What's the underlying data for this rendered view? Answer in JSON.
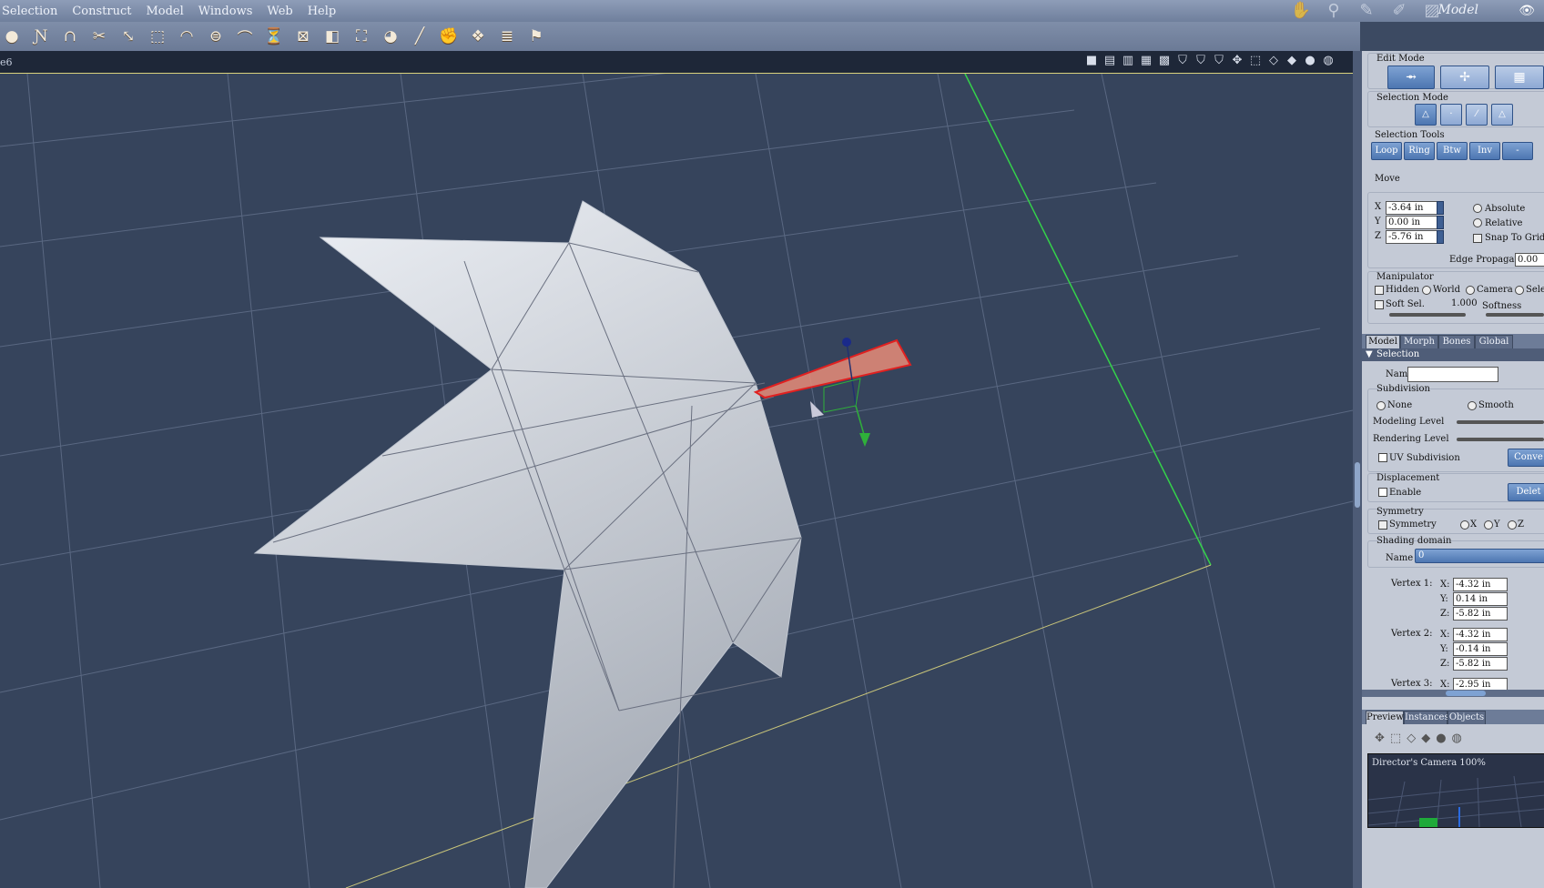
{
  "menu": [
    "Selection",
    "Construct",
    "Model",
    "Windows",
    "Web",
    "Help"
  ],
  "room": {
    "name": "Model",
    "tab_icons": [
      "hand-room-icon",
      "bone-room-icon",
      "pen-room-icon",
      "brush-room-icon",
      "cloth-room-icon"
    ]
  },
  "toolbar": {
    "icons": [
      "sphere-icon",
      "path-icon",
      "magnet-icon",
      "scissors-icon",
      "weld-icon",
      "bevel-icon",
      "dome-icon",
      "lathe-icon",
      "bend-icon",
      "taper-icon",
      "box-icon",
      "shaded-box-icon",
      "bag-icon",
      "half-sphere-icon",
      "line-icon",
      "grab-icon",
      "shape-icon",
      "stack-icon",
      "flag-icon"
    ]
  },
  "viewport": {
    "label": "e6"
  },
  "panel": {
    "edit_mode": {
      "title": "Edit Mode"
    },
    "selection_mode": {
      "title": "Selection Mode"
    },
    "selection_tools": {
      "title": "Selection Tools",
      "buttons": [
        "Loop",
        "Ring",
        "Btw",
        "Inv",
        "-"
      ]
    },
    "move": {
      "title": "Move",
      "x_label": "X",
      "x": "-3.64 in",
      "y_label": "Y",
      "y": "0.00 in",
      "z_label": "Z",
      "z": "-5.76 in",
      "absolute": "Absolute",
      "relative": "Relative",
      "snap": "Snap To Grid",
      "edge_prop_label": "Edge Propagation",
      "edge_prop": "0.00"
    },
    "manipulator": {
      "title": "Manipulator",
      "hidden": "Hidden",
      "world": "World",
      "camera": "Camera",
      "selec": "Selec",
      "soft_sel": "Soft Sel.",
      "soft_val": "1.000",
      "softness": "Softness"
    },
    "tabs": [
      "Model",
      "Morph",
      "Bones",
      "Global"
    ],
    "selection_header": "Selection",
    "name_label": "Name",
    "subdivision": {
      "title": "Subdivision",
      "none": "None",
      "smooth": "Smooth",
      "modeling": "Modeling Level",
      "rendering": "Rendering Level",
      "uv": "UV Subdivision",
      "conv": "Conve"
    },
    "displacement": {
      "title": "Displacement",
      "enable": "Enable",
      "delete": "Delet"
    },
    "symmetry": {
      "title": "Symmetry",
      "symmetry": "Symmetry",
      "x": "X",
      "y": "Y",
      "z": "Z"
    },
    "shading": {
      "title": "Shading domain",
      "name_label": "Name",
      "name_value": "0"
    },
    "vertices": [
      {
        "label": "Vertex 1:",
        "x": "-4.32 in",
        "y": "0.14 in",
        "z": "-5.82 in"
      },
      {
        "label": "Vertex 2:",
        "x": "-4.32 in",
        "y": "-0.14 in",
        "z": "-5.82 in"
      },
      {
        "label": "Vertex 3:",
        "x": "-2.95 in"
      }
    ],
    "axis_labels": {
      "x": "X:",
      "y": "Y:",
      "z": "Z:"
    },
    "bottom_tabs": [
      "Preview",
      "Instances",
      "Objects"
    ],
    "preview_label": "Director's Camera 100%"
  }
}
